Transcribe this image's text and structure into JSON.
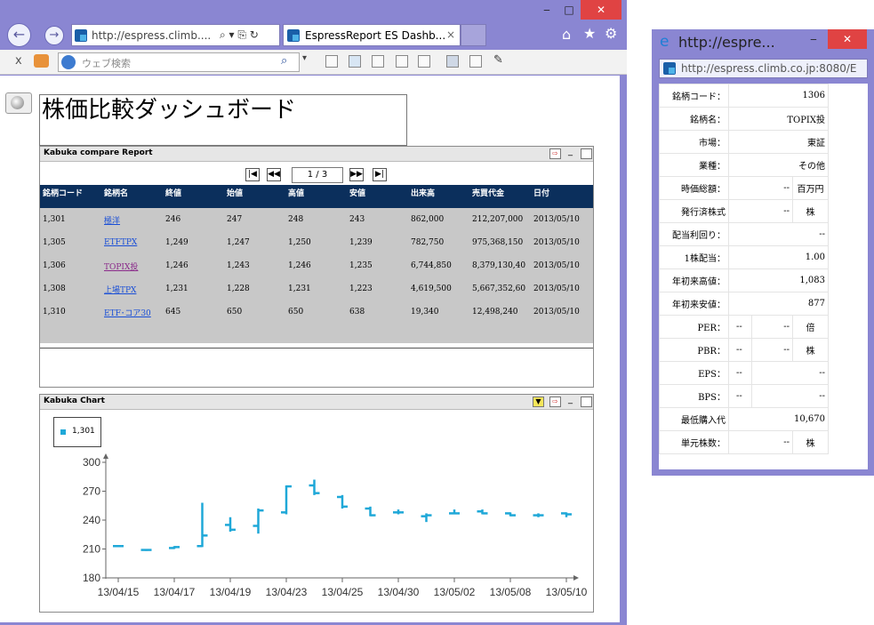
{
  "main_window": {
    "address": "http://espress.climb....",
    "address_icons": "⌕ ▾ ⎘ ↻",
    "tab_title": "EspressReport ES Dashb...",
    "tab_close": "×",
    "controls": {
      "minimize": "‒",
      "maximize": "□",
      "close": "✕"
    },
    "right_icons": [
      "home-icon",
      "star-icon",
      "gear-icon"
    ]
  },
  "toolbar": {
    "close_x": "x",
    "search_placeholder": "ウェブ検索"
  },
  "dashboard": {
    "title": "株価比較ダッシュボード"
  },
  "report": {
    "title": "Kabuka compare Report",
    "page_indicator": "1 / 3",
    "columns": [
      "銘柄コード",
      "銘柄名",
      "終値",
      "始値",
      "高値",
      "安値",
      "出来高",
      "売買代金",
      "日付"
    ],
    "rows": [
      [
        "1,301",
        "極洋",
        "246",
        "247",
        "248",
        "243",
        "862,000",
        "212,207,000",
        "2013/05/10"
      ],
      [
        "1,305",
        "ETFTPX",
        "1,249",
        "1,247",
        "1,250",
        "1,239",
        "782,750",
        "975,368,150",
        "2013/05/10"
      ],
      [
        "1,306",
        "TOPIX投",
        "1,246",
        "1,243",
        "1,246",
        "1,235",
        "6,744,850",
        "8,379,130,40",
        "2013/05/10"
      ],
      [
        "1,308",
        "上場TPX",
        "1,231",
        "1,228",
        "1,231",
        "1,223",
        "4,619,500",
        "5,667,352,60",
        "2013/05/10"
      ],
      [
        "1,310",
        "ETF･コア30",
        "645",
        "650",
        "650",
        "638",
        "19,340",
        "12,498,240",
        "2013/05/10"
      ]
    ]
  },
  "chart_panel": {
    "title": "Kabuka Chart"
  },
  "chart_data": {
    "type": "ohlc",
    "title": "",
    "legend": [
      "1,301"
    ],
    "legend_position": "top-left",
    "xlabel": "",
    "ylabel": "",
    "ylim": [
      180,
      300
    ],
    "yticks": [
      180,
      210,
      240,
      270,
      300
    ],
    "xtick_labels": [
      "13/04/15",
      "13/04/17",
      "13/04/19",
      "13/04/23",
      "13/04/25",
      "13/04/30",
      "13/05/02",
      "13/05/08",
      "13/05/10"
    ],
    "color": "#1fa8d8",
    "grid": false,
    "series": [
      {
        "name": "1,301",
        "points": [
          {
            "x": "13/04/15",
            "o": 213,
            "h": 214,
            "l": 212,
            "c": 213
          },
          {
            "x": "13/04/16",
            "o": 209,
            "h": 210,
            "l": 208,
            "c": 209
          },
          {
            "x": "13/04/17",
            "o": 211,
            "h": 213,
            "l": 210,
            "c": 212
          },
          {
            "x": "13/04/18",
            "o": 213,
            "h": 258,
            "l": 212,
            "c": 224
          },
          {
            "x": "13/04/19",
            "o": 235,
            "h": 243,
            "l": 228,
            "c": 230
          },
          {
            "x": "13/04/22",
            "o": 234,
            "h": 252,
            "l": 226,
            "c": 250
          },
          {
            "x": "13/04/23",
            "o": 248,
            "h": 276,
            "l": 246,
            "c": 275
          },
          {
            "x": "13/04/24",
            "o": 276,
            "h": 282,
            "l": 266,
            "c": 268
          },
          {
            "x": "13/04/25",
            "o": 264,
            "h": 266,
            "l": 252,
            "c": 254
          },
          {
            "x": "13/04/26",
            "o": 252,
            "h": 254,
            "l": 244,
            "c": 245
          },
          {
            "x": "13/04/30",
            "o": 248,
            "h": 251,
            "l": 246,
            "c": 248
          },
          {
            "x": "13/05/01",
            "o": 244,
            "h": 247,
            "l": 238,
            "c": 245
          },
          {
            "x": "13/05/02",
            "o": 247,
            "h": 251,
            "l": 246,
            "c": 247
          },
          {
            "x": "13/05/07",
            "o": 249,
            "h": 251,
            "l": 246,
            "c": 247
          },
          {
            "x": "13/05/08",
            "o": 247,
            "h": 248,
            "l": 244,
            "c": 245
          },
          {
            "x": "13/05/09",
            "o": 245,
            "h": 247,
            "l": 243,
            "c": 245
          },
          {
            "x": "13/05/10",
            "o": 247,
            "h": 248,
            "l": 243,
            "c": 246
          }
        ]
      }
    ]
  },
  "popup": {
    "title": "http://espre...",
    "controls": {
      "minimize": "‒",
      "maximize": "□",
      "close": "✕"
    },
    "address": "http://espress.climb.co.jp:8080/E",
    "rows": [
      {
        "label": "銘柄コード：",
        "value": "1306",
        "unit": ""
      },
      {
        "label": "銘柄名：",
        "value": "TOPIX投",
        "unit": ""
      },
      {
        "label": "市場：",
        "value": "東証",
        "unit": ""
      },
      {
        "label": "業種：",
        "value": "その他",
        "unit": ""
      },
      {
        "label": "時価総額：",
        "value": "--",
        "unit": "百万円"
      },
      {
        "label": "発行済株式",
        "value": "--",
        "unit": "株"
      },
      {
        "label": "配当利回り：",
        "value": "--",
        "unit": ""
      },
      {
        "label": "1株配当：",
        "value": "1.00",
        "unit": ""
      },
      {
        "label": "年初来高値：",
        "value": "1,083",
        "unit": ""
      },
      {
        "label": "年初来安値：",
        "value": "877",
        "unit": ""
      },
      {
        "label": "PER：",
        "pre": "--",
        "value": "--",
        "unit": "倍"
      },
      {
        "label": "PBR：",
        "pre": "--",
        "value": "--",
        "unit": "株"
      },
      {
        "label": "EPS：",
        "pre": "--",
        "value": "--",
        "unit": ""
      },
      {
        "label": "BPS：",
        "pre": "--",
        "value": "--",
        "unit": ""
      },
      {
        "label": "最低購入代",
        "value": "10,670",
        "unit": ""
      },
      {
        "label": "単元株数：",
        "value": "--",
        "unit": "株"
      }
    ]
  }
}
